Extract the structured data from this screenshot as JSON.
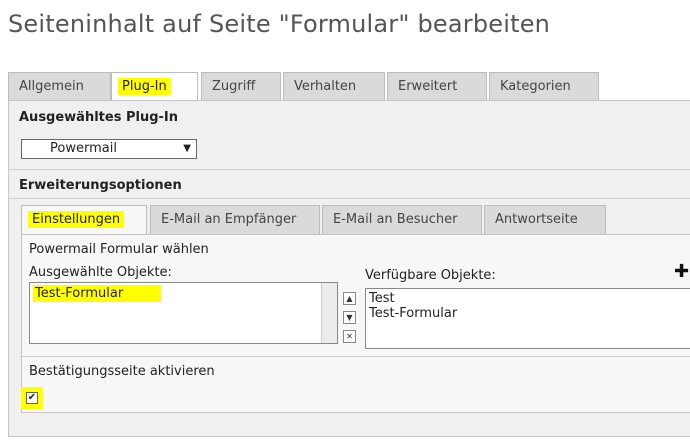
{
  "page": {
    "title": "Seiteninhalt auf Seite \"Formular\" bearbeiten"
  },
  "main_tabs": [
    {
      "label": "Allgemein"
    },
    {
      "label": "Plug-In"
    },
    {
      "label": "Zugriff"
    },
    {
      "label": "Verhalten"
    },
    {
      "label": "Erweitert"
    },
    {
      "label": "Kategorien"
    }
  ],
  "plugin_section": {
    "label": "Ausgewähltes Plug-In",
    "selected_value": "Powermail"
  },
  "extension_section": {
    "label": "Erweiterungsoptionen"
  },
  "inner_tabs": [
    {
      "label": "Einstellungen"
    },
    {
      "label": "E-Mail an Empfänger"
    },
    {
      "label": "E-Mail an Besucher"
    },
    {
      "label": "Antwortseite"
    }
  ],
  "form_chooser": {
    "label": "Powermail Formular wählen",
    "selected_label": "Ausgewählte Objekte:",
    "selected_items": [
      "Test-Formular"
    ],
    "available_label": "Verfügbare Objekte:",
    "available_items": [
      "Test",
      "Test-Formular"
    ]
  },
  "confirmation": {
    "label": "Bestätigungsseite aktivieren",
    "checked": true,
    "check_glyph": "✔"
  },
  "icons": {
    "move_up": "▲",
    "move_down": "▼",
    "remove": "✕",
    "add": "✚",
    "dropdown": "▼"
  },
  "colors": {
    "highlight": "#ffff00",
    "tab_inactive": "#dadada",
    "panel_bg": "#f0f0f0"
  }
}
